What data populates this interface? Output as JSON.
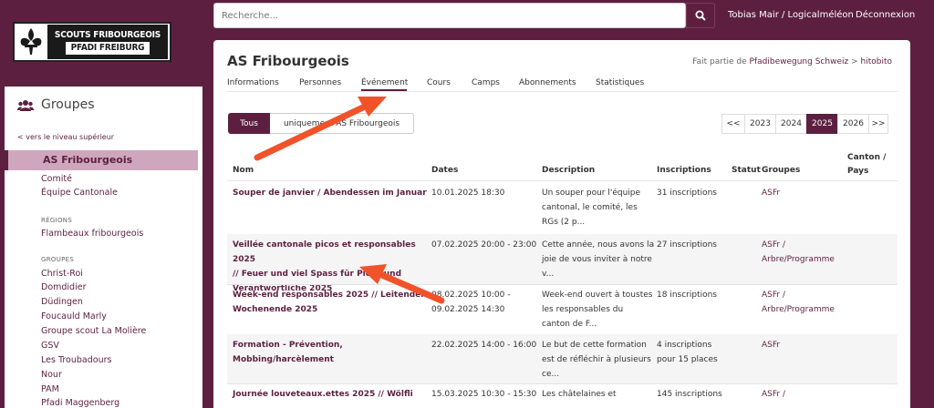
{
  "header": {
    "search_placeholder": "Recherche...",
    "user": "Tobias Mair / Logicalméléon",
    "logout": "Déconnexion"
  },
  "logo": {
    "line1": "SCOUTS FRIBOURGEOIS",
    "line2": "PFADI FREIBURG"
  },
  "sidebar": {
    "title": "Groupes",
    "up_link": "< vers le niveau supérieur",
    "active": "AS Fribourgeois",
    "top_items": [
      "Comité",
      "Équipe Cantonale"
    ],
    "regions_heading": "RÉGIONS",
    "regions": [
      "Flambeaux fribourgeois"
    ],
    "groups_heading": "GROUPES",
    "groups": [
      "Christ-Roi",
      "Domdidier",
      "Düdingen",
      "Foucauld Marly",
      "Groupe scout La Molière",
      "GSV",
      "Les Troubadours",
      "Nour",
      "PAM",
      "Pfadi Maggenberg"
    ]
  },
  "main": {
    "title": "AS Fribourgeois",
    "part_of_prefix": "Fait partie de",
    "part_of_link": "Pfadibewegung Schweiz",
    "part_of_sep": ">",
    "part_of_last": "hitobito",
    "tabs": [
      "Informations",
      "Personnes",
      "Événement",
      "Cours",
      "Camps",
      "Abonnements",
      "Statistiques"
    ],
    "active_tab": "Événement",
    "filter": {
      "all": "Tous",
      "only": "uniquement AS Fribourgeois"
    },
    "pager": [
      "<<",
      "2023",
      "2024",
      "2025",
      "2026",
      ">>"
    ],
    "pager_active": "2025",
    "columns": {
      "name": "Nom",
      "dates": "Dates",
      "description": "Description",
      "inscriptions": "Inscriptions",
      "status": "Statut",
      "groups": "Groupes",
      "canton_1": "Canton /",
      "canton_2": "Pays"
    },
    "rows": [
      {
        "name": [
          "Souper de janvier / Abendessen im Januar"
        ],
        "dates": [
          "10.01.2025 18:30"
        ],
        "description": [
          "Un souper pour l'équipe",
          "cantonal, le comité, les",
          "RGs (2 p..."
        ],
        "inscriptions": [
          "31 inscriptions"
        ],
        "groups": [
          "ASFr"
        ]
      },
      {
        "name": [
          "Veillée cantonale picos et responsables 2025",
          "// Feuer und viel Spass für Picos und",
          "Verantwortliche 2025"
        ],
        "dates": [
          "07.02.2025 20:00 - 23:00"
        ],
        "description": [
          "Cette année, nous avons la",
          "joie de vous inviter à notre",
          "v..."
        ],
        "inscriptions": [
          "27 inscriptions"
        ],
        "groups": [
          "ASFr /",
          "Arbre/Programme"
        ]
      },
      {
        "name": [
          "Week-end responsables 2025 // Leitenden",
          "Wochenende 2025"
        ],
        "dates": [
          "08.02.2025 10:00 -",
          "09.02.2025 14:30"
        ],
        "description": [
          "Week-end ouvert à toustes",
          "les responsables du",
          "canton de F..."
        ],
        "inscriptions": [
          "18 inscriptions"
        ],
        "groups": [
          "ASFr /",
          "Arbre/Programme"
        ]
      },
      {
        "name": [
          "Formation - Prévention,",
          "Mobbing/harcèlement"
        ],
        "dates": [
          "22.02.2025 14:00 - 16:00"
        ],
        "description": [
          "Le but de cette formation",
          "est de réfléchir à plusieurs",
          "ce..."
        ],
        "inscriptions": [
          "4 inscriptions",
          "pour 15 places"
        ],
        "groups": [
          "ASFr"
        ]
      },
      {
        "name": [
          "Journée louveteaux.ettes 2025 // Wölfli"
        ],
        "dates": [
          "15.03.2025 10:30 - 15:30"
        ],
        "description": [
          "Les châtelaines et"
        ],
        "inscriptions": [
          "145 inscriptions"
        ],
        "groups": [
          "ASFr /"
        ]
      }
    ]
  },
  "colors": {
    "brand": "#5d1f40",
    "active_bg": "#cfa7bd",
    "arrow": "#f0532a"
  }
}
